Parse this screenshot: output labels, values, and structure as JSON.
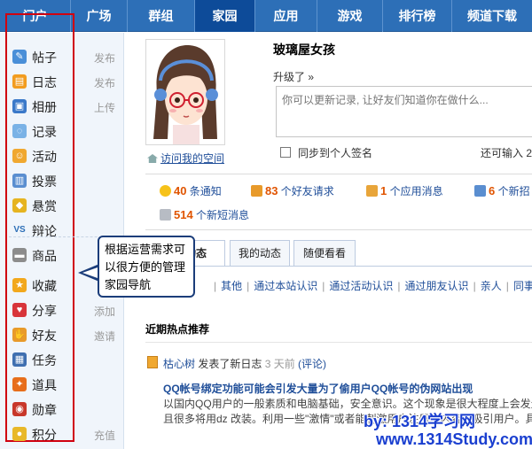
{
  "topnav": {
    "items": [
      {
        "label": "门户",
        "active": false
      },
      {
        "label": "广场",
        "active": false
      },
      {
        "label": "群组",
        "active": false
      },
      {
        "label": "家园",
        "active": true
      },
      {
        "label": "应用",
        "active": false
      },
      {
        "label": "游戏",
        "active": false
      },
      {
        "label": "排行榜",
        "active": false
      },
      {
        "label": "频道下载",
        "active": false
      }
    ]
  },
  "sidebar": {
    "items": [
      {
        "label": "帖子",
        "action": "发布",
        "icon": "post-icon",
        "color": "#4a8fd8"
      },
      {
        "label": "日志",
        "action": "发布",
        "icon": "blog-icon",
        "color": "#f29c1f"
      },
      {
        "label": "相册",
        "action": "上传",
        "icon": "album-icon",
        "color": "#3b79c9"
      },
      {
        "label": "记录",
        "action": "",
        "icon": "record-icon",
        "color": "#7ab2e6"
      },
      {
        "label": "活动",
        "action": "",
        "icon": "activity-icon",
        "color": "#f0a830"
      },
      {
        "label": "投票",
        "action": "",
        "icon": "poll-icon",
        "color": "#5a8ed0"
      },
      {
        "label": "悬赏",
        "action": "",
        "icon": "reward-icon",
        "color": "#e6b420"
      },
      {
        "label": "辩论",
        "action": "",
        "icon": "debate-icon",
        "color": "#2d6fb7"
      },
      {
        "label": "商品",
        "action": "",
        "icon": "goods-icon",
        "color": "#8c8c8c"
      },
      {
        "label": "收藏",
        "action": "",
        "icon": "favorite-icon",
        "color": "#f2a81c"
      },
      {
        "label": "分享",
        "action": "添加",
        "icon": "share-icon",
        "color": "#d8343a"
      },
      {
        "label": "好友",
        "action": "邀请",
        "icon": "friends-icon",
        "color": "#e89a2a"
      },
      {
        "label": "任务",
        "action": "",
        "icon": "task-icon",
        "color": "#3f6fb0"
      },
      {
        "label": "道具",
        "action": "",
        "icon": "props-icon",
        "color": "#e76e1b"
      },
      {
        "label": "勋章",
        "action": "",
        "icon": "medal-icon",
        "color": "#c8372a"
      },
      {
        "label": "积分",
        "action": "充值",
        "icon": "points-icon",
        "color": "#e8b828"
      }
    ]
  },
  "callout": {
    "text": "根据运营需求可以很方便的管理家园导航"
  },
  "profile": {
    "username": "玻璃屋女孩",
    "upgrade": "升级了 »",
    "status_placeholder": "你可以更新记录, 让好友们知道你在做什么...",
    "sync_label": "同步到个人签名",
    "remain": "还可输入 2",
    "visit_link": "访问我的空间"
  },
  "notices": [
    {
      "num": "40",
      "text": " 条通知",
      "icon": "bulb-icon",
      "color": "#f6c21a"
    },
    {
      "num": "83",
      "text": " 个好友请求",
      "icon": "handshake-icon",
      "color": "#e89a2a"
    },
    {
      "num": "1",
      "text": " 个应用消息",
      "icon": "box-icon",
      "color": "#e8a53a"
    },
    {
      "num": "6",
      "text": " 个新招",
      "icon": "people-icon",
      "color": "#5a8ed0"
    },
    {
      "num": "514",
      "text": " 个新短消息",
      "icon": "mail-icon",
      "color": "#b7bcc4"
    }
  ],
  "tabs": [
    {
      "label": "好友动态",
      "active": true
    },
    {
      "label": "我的动态",
      "active": false
    },
    {
      "label": "随便看看",
      "active": false
    }
  ],
  "subnav": [
    "其他",
    "通过本站认识",
    "通过活动认识",
    "通过朋友认识",
    "亲人",
    "同事"
  ],
  "hot_title": "近期热点推荐",
  "feed": {
    "user": "枯心树",
    "action": " 发表了新日志 ",
    "time": "3 天前",
    "comment": "(评论)",
    "title": "QQ帐号绑定功能可能会引发大量为了偷用户QQ帐号的伪网站出现",
    "body1": "以国内QQ用户的一般素质和电脑基础，安全意识。这个现象是很大程度上会发生",
    "body2": "且很多将用dz 改装。利用一些\"激情\"或者能刺激用户注册的内容来吸引用户。具体"
  },
  "watermark": {
    "line1": "by: 1314学习网",
    "line2": "www.1314Study.com"
  }
}
